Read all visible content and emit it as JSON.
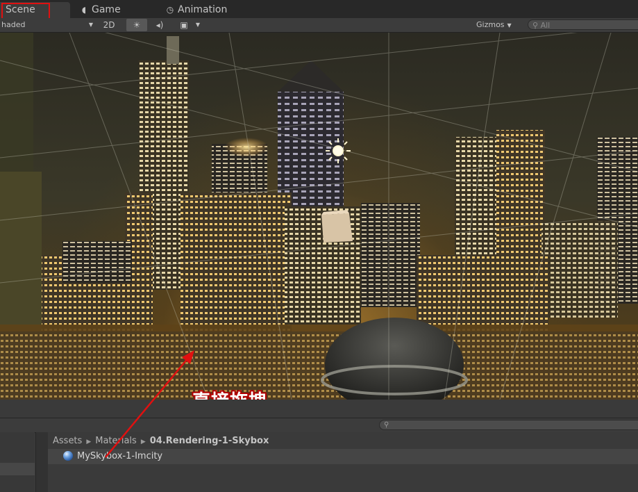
{
  "tabs": {
    "scene": "Scene",
    "game": "Game",
    "animation": "Animation"
  },
  "toolbar": {
    "shading_mode": "haded",
    "view_2d": "2D",
    "gizmos": "Gizmos",
    "search_placeholder": "All"
  },
  "annotation": {
    "text": "直接拖拽",
    "color": "#e01010"
  },
  "project": {
    "breadcrumb": [
      "Assets",
      "Materials",
      "04.Rendering-1-Skybox"
    ],
    "asset_name": "MySkybox-1-Imcity"
  },
  "icons": {
    "game_tab": "pacman-icon",
    "animation_tab": "clock-icon",
    "light_toggle": "sun-icon",
    "audio_toggle": "speaker-icon",
    "effects_toggle": "image-icon",
    "search": "magnifier-icon",
    "material": "sphere-material-icon"
  }
}
